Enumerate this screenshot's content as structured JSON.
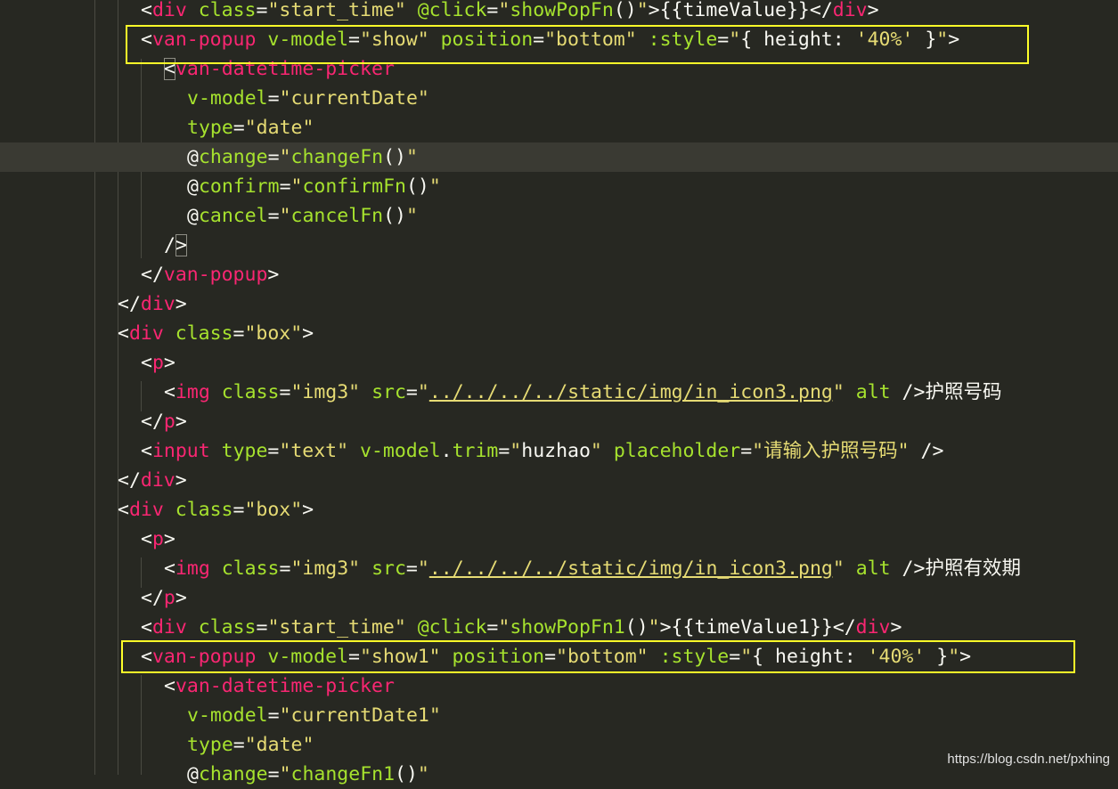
{
  "editor": {
    "lines": [
      {
        "tokens": [
          {
            "c": "p",
            "t": "<"
          },
          {
            "c": "t",
            "t": "div"
          },
          {
            "c": "p",
            "t": " "
          },
          {
            "c": "a",
            "t": "class"
          },
          {
            "c": "p",
            "t": "="
          },
          {
            "c": "s",
            "t": "\"start_time\""
          },
          {
            "c": "p",
            "t": " "
          },
          {
            "c": "a",
            "t": "@click"
          },
          {
            "c": "p",
            "t": "="
          },
          {
            "c": "s",
            "t": "\""
          },
          {
            "c": "a",
            "t": "showPopFn"
          },
          {
            "c": "p",
            "t": "()"
          },
          {
            "c": "s",
            "t": "\""
          },
          {
            "c": "p",
            "t": ">{{timeValue}}</"
          },
          {
            "c": "t",
            "t": "div"
          },
          {
            "c": "p",
            "t": ">"
          }
        ]
      },
      {
        "tokens": [
          {
            "c": "p",
            "t": "<"
          },
          {
            "c": "t",
            "t": "van-popup"
          },
          {
            "c": "p",
            "t": " "
          },
          {
            "c": "a",
            "t": "v-model"
          },
          {
            "c": "p",
            "t": "="
          },
          {
            "c": "s",
            "t": "\"show\""
          },
          {
            "c": "p",
            "t": " "
          },
          {
            "c": "a",
            "t": "position"
          },
          {
            "c": "p",
            "t": "="
          },
          {
            "c": "s",
            "t": "\"bottom\""
          },
          {
            "c": "p",
            "t": " "
          },
          {
            "c": "a",
            "t": ":style"
          },
          {
            "c": "p",
            "t": "="
          },
          {
            "c": "s",
            "t": "\""
          },
          {
            "c": "p",
            "t": "{ height: "
          },
          {
            "c": "s",
            "t": "'40%'"
          },
          {
            "c": "p",
            "t": " }"
          },
          {
            "c": "s",
            "t": "\""
          },
          {
            "c": "p",
            "t": ">"
          }
        ]
      },
      {
        "tokens": [
          {
            "c": "p",
            "t": "<",
            "m": "bracket"
          },
          {
            "c": "t",
            "t": "van-datetime-picker"
          }
        ]
      },
      {
        "tokens": [
          {
            "c": "a",
            "t": "v-model"
          },
          {
            "c": "p",
            "t": "="
          },
          {
            "c": "s",
            "t": "\"currentDate\""
          }
        ]
      },
      {
        "tokens": [
          {
            "c": "a",
            "t": "type"
          },
          {
            "c": "p",
            "t": "="
          },
          {
            "c": "s",
            "t": "\"date\""
          }
        ]
      },
      {
        "tokens": [
          {
            "c": "p",
            "t": "@"
          },
          {
            "c": "a",
            "t": "change"
          },
          {
            "c": "p",
            "t": "="
          },
          {
            "c": "s",
            "t": "\""
          },
          {
            "c": "a",
            "t": "changeFn"
          },
          {
            "c": "p",
            "t": "()"
          },
          {
            "c": "s",
            "t": "\""
          }
        ]
      },
      {
        "tokens": [
          {
            "c": "p",
            "t": "@"
          },
          {
            "c": "a",
            "t": "confirm"
          },
          {
            "c": "p",
            "t": "="
          },
          {
            "c": "s",
            "t": "\""
          },
          {
            "c": "a",
            "t": "confirmFn"
          },
          {
            "c": "p",
            "t": "()"
          },
          {
            "c": "s",
            "t": "\""
          }
        ]
      },
      {
        "tokens": [
          {
            "c": "p",
            "t": "@"
          },
          {
            "c": "a",
            "t": "cancel"
          },
          {
            "c": "p",
            "t": "="
          },
          {
            "c": "s",
            "t": "\""
          },
          {
            "c": "a",
            "t": "cancelFn"
          },
          {
            "c": "p",
            "t": "()"
          },
          {
            "c": "s",
            "t": "\""
          }
        ]
      },
      {
        "tokens": [
          {
            "c": "p",
            "t": "/"
          },
          {
            "c": "p",
            "t": ">",
            "m": "bracket"
          }
        ]
      },
      {
        "tokens": [
          {
            "c": "p",
            "t": "</"
          },
          {
            "c": "t",
            "t": "van-popup"
          },
          {
            "c": "p",
            "t": ">"
          }
        ]
      },
      {
        "tokens": [
          {
            "c": "p",
            "t": "</"
          },
          {
            "c": "t",
            "t": "div"
          },
          {
            "c": "p",
            "t": ">"
          }
        ]
      },
      {
        "tokens": [
          {
            "c": "p",
            "t": "<"
          },
          {
            "c": "t",
            "t": "div"
          },
          {
            "c": "p",
            "t": " "
          },
          {
            "c": "a",
            "t": "class"
          },
          {
            "c": "p",
            "t": "="
          },
          {
            "c": "s",
            "t": "\"box\""
          },
          {
            "c": "p",
            "t": ">"
          }
        ]
      },
      {
        "tokens": [
          {
            "c": "p",
            "t": "<"
          },
          {
            "c": "t",
            "t": "p"
          },
          {
            "c": "p",
            "t": ">"
          }
        ]
      },
      {
        "tokens": [
          {
            "c": "p",
            "t": "<"
          },
          {
            "c": "t",
            "t": "img"
          },
          {
            "c": "p",
            "t": " "
          },
          {
            "c": "a",
            "t": "class"
          },
          {
            "c": "p",
            "t": "="
          },
          {
            "c": "s",
            "t": "\"img3\""
          },
          {
            "c": "p",
            "t": " "
          },
          {
            "c": "a",
            "t": "src"
          },
          {
            "c": "p",
            "t": "="
          },
          {
            "c": "s",
            "t": "\""
          },
          {
            "c": "s",
            "t": "../../../../static/img/in_icon3.png",
            "m": "link"
          },
          {
            "c": "s",
            "t": "\""
          },
          {
            "c": "p",
            "t": " "
          },
          {
            "c": "a",
            "t": "alt"
          },
          {
            "c": "p",
            "t": " />护照号码"
          }
        ]
      },
      {
        "tokens": [
          {
            "c": "p",
            "t": "</"
          },
          {
            "c": "t",
            "t": "p"
          },
          {
            "c": "p",
            "t": ">"
          }
        ]
      },
      {
        "tokens": [
          {
            "c": "p",
            "t": "<"
          },
          {
            "c": "t",
            "t": "input"
          },
          {
            "c": "p",
            "t": " "
          },
          {
            "c": "a",
            "t": "type"
          },
          {
            "c": "p",
            "t": "="
          },
          {
            "c": "s",
            "t": "\"text\""
          },
          {
            "c": "p",
            "t": " "
          },
          {
            "c": "a",
            "t": "v-model"
          },
          {
            "c": "p",
            "t": "."
          },
          {
            "c": "a",
            "t": "trim"
          },
          {
            "c": "p",
            "t": "="
          },
          {
            "c": "s",
            "t": "\""
          },
          {
            "c": "p",
            "t": "huzhao"
          },
          {
            "c": "s",
            "t": "\""
          },
          {
            "c": "p",
            "t": " "
          },
          {
            "c": "a",
            "t": "placeholder"
          },
          {
            "c": "p",
            "t": "="
          },
          {
            "c": "s",
            "t": "\"请输入护照号码\""
          },
          {
            "c": "p",
            "t": " />"
          }
        ]
      },
      {
        "tokens": [
          {
            "c": "p",
            "t": "</"
          },
          {
            "c": "t",
            "t": "div"
          },
          {
            "c": "p",
            "t": ">"
          }
        ]
      },
      {
        "tokens": [
          {
            "c": "p",
            "t": "<"
          },
          {
            "c": "t",
            "t": "div"
          },
          {
            "c": "p",
            "t": " "
          },
          {
            "c": "a",
            "t": "class"
          },
          {
            "c": "p",
            "t": "="
          },
          {
            "c": "s",
            "t": "\"box\""
          },
          {
            "c": "p",
            "t": ">"
          }
        ]
      },
      {
        "tokens": [
          {
            "c": "p",
            "t": "<"
          },
          {
            "c": "t",
            "t": "p"
          },
          {
            "c": "p",
            "t": ">"
          }
        ]
      },
      {
        "tokens": [
          {
            "c": "p",
            "t": "<"
          },
          {
            "c": "t",
            "t": "img"
          },
          {
            "c": "p",
            "t": " "
          },
          {
            "c": "a",
            "t": "class"
          },
          {
            "c": "p",
            "t": "="
          },
          {
            "c": "s",
            "t": "\"img3\""
          },
          {
            "c": "p",
            "t": " "
          },
          {
            "c": "a",
            "t": "src"
          },
          {
            "c": "p",
            "t": "="
          },
          {
            "c": "s",
            "t": "\""
          },
          {
            "c": "s",
            "t": "../../../../static/img/in_icon3.png",
            "m": "link"
          },
          {
            "c": "s",
            "t": "\""
          },
          {
            "c": "p",
            "t": " "
          },
          {
            "c": "a",
            "t": "alt"
          },
          {
            "c": "p",
            "t": " />护照有效期"
          }
        ]
      },
      {
        "tokens": [
          {
            "c": "p",
            "t": "</"
          },
          {
            "c": "t",
            "t": "p"
          },
          {
            "c": "p",
            "t": ">"
          }
        ]
      },
      {
        "tokens": [
          {
            "c": "p",
            "t": "<"
          },
          {
            "c": "t",
            "t": "div"
          },
          {
            "c": "p",
            "t": " "
          },
          {
            "c": "a",
            "t": "class"
          },
          {
            "c": "p",
            "t": "="
          },
          {
            "c": "s",
            "t": "\"start_time\""
          },
          {
            "c": "p",
            "t": " "
          },
          {
            "c": "a",
            "t": "@click"
          },
          {
            "c": "p",
            "t": "="
          },
          {
            "c": "s",
            "t": "\""
          },
          {
            "c": "a",
            "t": "showPopFn1"
          },
          {
            "c": "p",
            "t": "()"
          },
          {
            "c": "s",
            "t": "\""
          },
          {
            "c": "p",
            "t": ">{{timeValue1}}</"
          },
          {
            "c": "t",
            "t": "div"
          },
          {
            "c": "p",
            "t": ">"
          }
        ]
      },
      {
        "tokens": [
          {
            "c": "p",
            "t": "<"
          },
          {
            "c": "t",
            "t": "van-popup"
          },
          {
            "c": "p",
            "t": " "
          },
          {
            "c": "a",
            "t": "v-model"
          },
          {
            "c": "p",
            "t": "="
          },
          {
            "c": "s",
            "t": "\"show1\""
          },
          {
            "c": "p",
            "t": " "
          },
          {
            "c": "a",
            "t": "position"
          },
          {
            "c": "p",
            "t": "="
          },
          {
            "c": "s",
            "t": "\"bottom\""
          },
          {
            "c": "p",
            "t": " "
          },
          {
            "c": "a",
            "t": ":style"
          },
          {
            "c": "p",
            "t": "="
          },
          {
            "c": "s",
            "t": "\""
          },
          {
            "c": "p",
            "t": "{ height: "
          },
          {
            "c": "s",
            "t": "'40%'"
          },
          {
            "c": "p",
            "t": " }"
          },
          {
            "c": "s",
            "t": "\""
          },
          {
            "c": "p",
            "t": ">"
          }
        ]
      },
      {
        "tokens": [
          {
            "c": "p",
            "t": "<"
          },
          {
            "c": "t",
            "t": "van-datetime-picker"
          }
        ]
      },
      {
        "tokens": [
          {
            "c": "a",
            "t": "v-model"
          },
          {
            "c": "p",
            "t": "="
          },
          {
            "c": "s",
            "t": "\"currentDate1\""
          }
        ]
      },
      {
        "tokens": [
          {
            "c": "a",
            "t": "type"
          },
          {
            "c": "p",
            "t": "="
          },
          {
            "c": "s",
            "t": "\"date\""
          }
        ]
      },
      {
        "tokens": [
          {
            "c": "p",
            "t": "@"
          },
          {
            "c": "a",
            "t": "change"
          },
          {
            "c": "p",
            "t": "="
          },
          {
            "c": "s",
            "t": "\""
          },
          {
            "c": "a",
            "t": "changeFn1"
          },
          {
            "c": "p",
            "t": "()"
          },
          {
            "c": "s",
            "t": "\""
          }
        ]
      }
    ]
  },
  "colors": {
    "background": "#272822",
    "plain": "#f8f8f2",
    "tag": "#f92672",
    "attribute": "#a6e22e",
    "string": "#e6db74",
    "highlight_box": "#ffff29"
  },
  "watermark": "https://blog.csdn.net/pxhing"
}
